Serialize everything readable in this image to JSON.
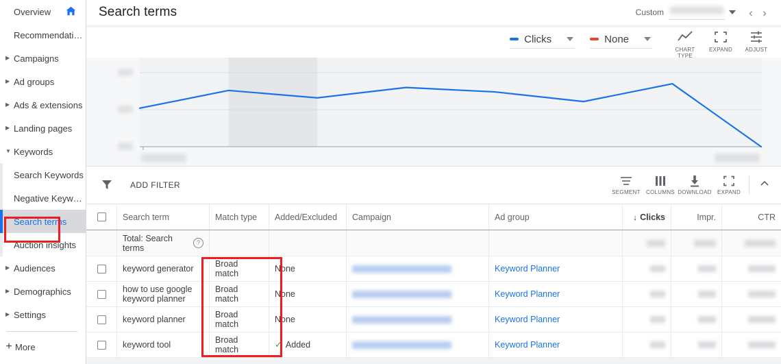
{
  "sidebar": {
    "items": [
      {
        "label": "Overview",
        "caret": "",
        "indent": false,
        "selected": false,
        "home": true
      },
      {
        "label": "Recommendations",
        "caret": "",
        "indent": false,
        "selected": false,
        "home": false
      },
      {
        "label": "Campaigns",
        "caret": "▶",
        "indent": false,
        "selected": false,
        "home": false
      },
      {
        "label": "Ad groups",
        "caret": "▶",
        "indent": false,
        "selected": false,
        "home": false
      },
      {
        "label": "Ads & extensions",
        "caret": "▶",
        "indent": false,
        "selected": false,
        "home": false
      },
      {
        "label": "Landing pages",
        "caret": "▶",
        "indent": false,
        "selected": false,
        "home": false
      },
      {
        "label": "Keywords",
        "caret": "▼",
        "indent": false,
        "selected": false,
        "home": false
      },
      {
        "label": "Search Keywords",
        "caret": "",
        "indent": true,
        "selected": false,
        "home": false
      },
      {
        "label": "Negative Keywords",
        "caret": "",
        "indent": true,
        "selected": false,
        "home": false
      },
      {
        "label": "Search terms",
        "caret": "",
        "indent": true,
        "selected": true,
        "home": false
      },
      {
        "label": "Auction insights",
        "caret": "",
        "indent": true,
        "selected": false,
        "home": false
      },
      {
        "label": "Audiences",
        "caret": "▶",
        "indent": false,
        "selected": false,
        "home": false
      },
      {
        "label": "Demographics",
        "caret": "▶",
        "indent": false,
        "selected": false,
        "home": false
      },
      {
        "label": "Settings",
        "caret": "▶",
        "indent": false,
        "selected": false,
        "home": false
      }
    ],
    "more_label": "More",
    "more_icon": "+",
    "home_icon": "home-icon"
  },
  "header": {
    "title": "Search terms",
    "date_range_label": "Custom",
    "date_range_value": "",
    "prev_icon": "‹",
    "next_icon": "›"
  },
  "chart_controls": {
    "metric_primary": {
      "label": "Clicks",
      "color": "#1a73e8"
    },
    "metric_secondary": {
      "label": "None",
      "color": "#ea4335"
    },
    "buttons": [
      {
        "caption": "CHART TYPE",
        "icon": "line-chart-icon"
      },
      {
        "caption": "EXPAND",
        "icon": "expand-icon"
      },
      {
        "caption": "ADJUST",
        "icon": "adjust-icon"
      }
    ]
  },
  "chart_data": {
    "type": "line",
    "title": "",
    "xlabel": "",
    "ylabel": "",
    "series": [
      {
        "name": "Clicks",
        "color": "#1a73e8",
        "values": [
          52,
          76,
          66,
          80,
          74,
          61,
          85,
          0
        ]
      }
    ],
    "x": [
      "",
      "",
      "",
      "",
      "",
      "",
      "",
      ""
    ],
    "ylim": [
      0,
      100
    ],
    "ytick_labels": [
      "",
      "",
      ""
    ],
    "xtick_labels": [
      "",
      ""
    ],
    "grid": true,
    "legend": "none",
    "highlight_band": {
      "from_index": 1,
      "to_index": 2
    }
  },
  "toolbar": {
    "filter_icon": "filter-icon",
    "add_filter_label": "ADD FILTER",
    "buttons": [
      {
        "caption": "SEGMENT",
        "icon": "segment-icon"
      },
      {
        "caption": "COLUMNS",
        "icon": "columns-icon"
      },
      {
        "caption": "DOWNLOAD",
        "icon": "download-icon"
      },
      {
        "caption": "EXPAND",
        "icon": "expand-icon"
      }
    ],
    "collapse_icon": "chevron-up-icon"
  },
  "table": {
    "columns": [
      "Search term",
      "Match type",
      "Added/Excluded",
      "Campaign",
      "Ad group",
      "Clicks",
      "Impr.",
      "CTR"
    ],
    "sort_column": "Clicks",
    "sort_direction": "↓",
    "total_row_label": "Total: Search terms",
    "rows": [
      {
        "search_term": "keyword generator",
        "match_type": "Broad match",
        "added_excluded": "None",
        "added_is_checked": false,
        "campaign": "",
        "ad_group": "Keyword Planner",
        "clicks": "",
        "impr": "",
        "ctr": ""
      },
      {
        "search_term": "how to use google keyword planner",
        "match_type": "Broad match",
        "added_excluded": "None",
        "added_is_checked": false,
        "campaign": "",
        "ad_group": "Keyword Planner",
        "clicks": "",
        "impr": "",
        "ctr": ""
      },
      {
        "search_term": "keyword planner",
        "match_type": "Broad match",
        "added_excluded": "None",
        "added_is_checked": false,
        "campaign": "",
        "ad_group": "Keyword Planner",
        "clicks": "",
        "impr": "",
        "ctr": ""
      },
      {
        "search_term": "keyword tool",
        "match_type": "Broad match",
        "added_excluded": "Added",
        "added_is_checked": true,
        "campaign": "",
        "ad_group": "Keyword Planner",
        "clicks": "",
        "impr": "",
        "ctr": ""
      }
    ]
  },
  "annotations": {
    "color": "#ee1d23",
    "boxes": [
      "sidebar-search-terms",
      "search-term-column"
    ]
  }
}
